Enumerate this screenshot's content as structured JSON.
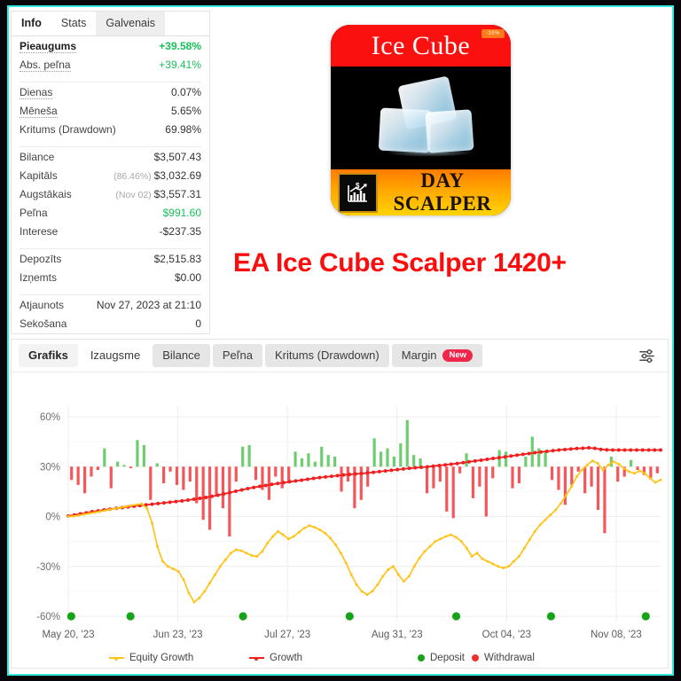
{
  "colors": {
    "frame_outer": "#07060b",
    "frame_accent": "#35e8e0",
    "positive": "#17bf5a",
    "bar_up": "#62c962",
    "bar_down": "#f4484b",
    "growth_line": "#f02020",
    "equity_line": "#ffc319",
    "deposit": "#17a317",
    "withdrawal": "#f23030",
    "headline": "#fb0d0d",
    "badge": "#f0274b"
  },
  "stats_panel": {
    "tabs": [
      {
        "label": "Info",
        "state": "active"
      },
      {
        "label": "Stats",
        "state": "plain"
      },
      {
        "label": "Galvenais",
        "state": "shade"
      }
    ],
    "groups": [
      {
        "rows": [
          {
            "label": "Pieaugums",
            "value": "+39.58%",
            "value_class": "green",
            "strong": true,
            "dotted": true
          },
          {
            "label": "Abs. peľna",
            "value": "+39.41%",
            "value_class": "green",
            "strong": false,
            "dotted": true
          }
        ]
      },
      {
        "rows": [
          {
            "label": "Dienas",
            "value": "0.07%",
            "dotted": true
          },
          {
            "label": "Mēneša",
            "value": "5.65%",
            "dotted": true
          },
          {
            "label": "Kritums (Drawdown)",
            "value": "69.98%",
            "dotted": false
          }
        ]
      },
      {
        "rows": [
          {
            "label": "Bilance",
            "value": "$3,507.43"
          },
          {
            "label": "Kapitāls",
            "prefix": "(86.46%)",
            "value": "$3,032.69"
          },
          {
            "label": "Augstākais",
            "prefix": "(Nov 02)",
            "prefix_muted": true,
            "value": "$3,557.31"
          },
          {
            "label": "Peľna",
            "value": "$991.60",
            "value_class": "green"
          },
          {
            "label": "Interese",
            "value": "-$237.35"
          }
        ]
      },
      {
        "rows": [
          {
            "label": "Depozīts",
            "value": "$2,515.83"
          },
          {
            "label": "Izņemts",
            "value": "$0.00"
          }
        ]
      },
      {
        "rows": [
          {
            "label": "Atjaunots",
            "value": "Nov 27, 2023 at 21:10"
          },
          {
            "label": "Sekošana",
            "value": "0"
          }
        ]
      }
    ]
  },
  "logo": {
    "title": "Ice Cube",
    "subtitle": "DAY SCALPER",
    "corner_badge": "-30%",
    "icon_name": "stock-chart-dollar-icon"
  },
  "headline": {
    "text": "EA Ice Cube Scalper 1420+"
  },
  "chart_card": {
    "tabs": [
      {
        "label": "Grafiks",
        "style": "first",
        "badge": null
      },
      {
        "label": "Izaugsme",
        "style": "white",
        "badge": null
      },
      {
        "label": "Bilance",
        "style": "grey",
        "badge": null
      },
      {
        "label": "Peľna",
        "style": "grey",
        "badge": null
      },
      {
        "label": "Kritums (Drawdown)",
        "style": "grey",
        "badge": null
      },
      {
        "label": "Margin",
        "style": "grey",
        "badge": "New"
      }
    ],
    "settings_icon": "sliders-icon"
  },
  "chart_data": {
    "type": "line",
    "title": "Izaugsme",
    "xlabel": "",
    "ylabel": "",
    "ylim": [
      -60,
      60
    ],
    "yticks": [
      60,
      30,
      0,
      -30,
      -60
    ],
    "ytick_labels": [
      "60%",
      "30%",
      "0%",
      "-30%",
      "-60%"
    ],
    "grid": true,
    "legend_position": "bottom",
    "x_tick_labels": [
      "May 20, '23",
      "Jun 23, '23",
      "Jul 27, '23",
      "Aug 31, '23",
      "Oct 04, '23",
      "Nov 08, '23"
    ],
    "x_tick_positions": [
      0,
      18.5,
      37,
      55.5,
      74,
      92.5
    ],
    "legend": [
      {
        "name": "Equity Growth",
        "type": "line",
        "color": "#ffc319"
      },
      {
        "name": "Growth",
        "type": "line",
        "color": "#f02020"
      },
      {
        "name": "Deposit",
        "type": "dot",
        "color": "#17a317"
      },
      {
        "name": "Withdrawal",
        "type": "dot",
        "color": "#f23030"
      }
    ],
    "series": [
      {
        "name": "Growth",
        "color": "#f02020",
        "style": "dotted-marker-line",
        "values": [
          0.3,
          0.9,
          1.6,
          2.2,
          2.9,
          3.4,
          4.0,
          4.4,
          4.9,
          5.3,
          5.8,
          6.2,
          6.6,
          7.0,
          7.4,
          7.8,
          8.2,
          8.6,
          9.0,
          9.4,
          9.9,
          10.4,
          10.9,
          11.5,
          12.1,
          12.8,
          13.6,
          14.4,
          15.2,
          16.0,
          16.8,
          17.5,
          18.1,
          18.7,
          19.3,
          19.9,
          20.4,
          20.9,
          21.4,
          21.9,
          22.4,
          22.9,
          23.4,
          23.8,
          24.2,
          24.6,
          25.0,
          25.3,
          25.6,
          25.9,
          26.2,
          26.6,
          27.0,
          27.4,
          27.8,
          28.2,
          28.6,
          29.0,
          29.3,
          29.6,
          29.9,
          30.3,
          30.7,
          31.1,
          31.5,
          31.9,
          32.4,
          32.9,
          33.4,
          33.9,
          34.4,
          34.9,
          35.4,
          35.9,
          36.4,
          36.9,
          37.4,
          37.9,
          38.4,
          38.8,
          39.2,
          39.6,
          40.0,
          40.3,
          40.6,
          40.9,
          41.1,
          41.3,
          41.0,
          40.4,
          40.1,
          40.0,
          40.0,
          40.0,
          40.0,
          40.0,
          40.0,
          40.0,
          40.0,
          40.0
        ]
      },
      {
        "name": "Equity Growth",
        "color": "#ffc319",
        "style": "line-markers",
        "values": [
          0.0,
          0.2,
          0.7,
          1.3,
          1.9,
          2.4,
          3.0,
          3.6,
          4.2,
          4.8,
          5.4,
          6.0,
          6.6,
          7.1,
          7.6,
          5.0,
          -4.0,
          -18.0,
          -27.0,
          -30.0,
          -31.5,
          -33.0,
          -38.0,
          -46.0,
          -51.5,
          -49.0,
          -45.0,
          -40.0,
          -35.0,
          -30.0,
          -26.0,
          -22.0,
          -20.0,
          -20.5,
          -22.0,
          -23.5,
          -24.0,
          -21.0,
          -16.0,
          -12.0,
          -9.0,
          -11.0,
          -13.5,
          -12.0,
          -9.5,
          -7.0,
          -5.5,
          -6.5,
          -8.0,
          -10.0,
          -13.0,
          -17.0,
          -22.0,
          -28.0,
          -35.0,
          -41.0,
          -45.0,
          -47.0,
          -45.0,
          -41.0,
          -36.0,
          -32.0,
          -30.0,
          -35.0,
          -39.0,
          -36.0,
          -30.0,
          -25.0,
          -21.0,
          -18.0,
          -15.0,
          -13.5,
          -12.0,
          -11.0,
          -12.5,
          -15.0,
          -19.0,
          -24.0,
          -22.0,
          -25.5,
          -27.0,
          -28.5,
          -30.0,
          -31.0,
          -30.0,
          -27.0,
          -24.0,
          -19.0,
          -14.0,
          -9.0,
          -5.0,
          -2.0,
          1.0,
          4.0,
          8.0,
          13.0,
          18.0,
          24.0,
          28.0,
          31.0,
          33.5,
          32.0,
          28.0,
          31.0,
          33.0,
          31.5,
          29.0,
          27.0,
          26.0,
          27.5,
          26.0,
          23.0,
          20.5,
          22.0
        ]
      }
    ],
    "bars": {
      "name": "Daily result",
      "baseline": 30,
      "up_color": "#62c962",
      "down_color": "#f4484b",
      "values": [
        -8,
        -11,
        -16,
        -6,
        -2,
        11,
        -13,
        3,
        1,
        -1,
        16,
        13,
        -20,
        2,
        -10,
        -3,
        -11,
        -14,
        -9,
        -22,
        -32,
        -38,
        -17,
        -25,
        -42,
        -9,
        12,
        13,
        -8,
        -14,
        -20,
        -6,
        -13,
        -10,
        9,
        5,
        8,
        3,
        12,
        7,
        6,
        -15,
        -9,
        -25,
        -20,
        -12,
        17,
        9,
        11,
        6,
        14,
        28,
        7,
        5,
        -16,
        -13,
        -9,
        -27,
        -31,
        -4,
        8,
        -19,
        -12,
        -30,
        -7,
        10,
        9,
        -13,
        -10,
        6,
        18,
        11,
        9,
        -8,
        -14,
        -23,
        -11,
        -3,
        -16,
        -12,
        -26,
        -40,
        6,
        -9,
        -6,
        4,
        -2,
        -5,
        -7,
        -4
      ]
    },
    "deposit_markers": {
      "color": "#17a317",
      "y": -60,
      "x_percent": [
        0.5,
        10.5,
        29.5,
        47.5,
        65.5,
        81.5,
        97.5
      ]
    }
  }
}
